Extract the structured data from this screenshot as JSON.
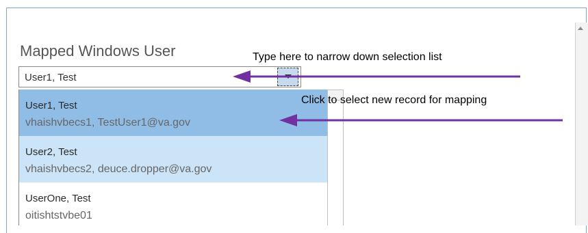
{
  "field": {
    "title": "Mapped Windows User",
    "value": "User1, Test"
  },
  "options": [
    {
      "name": "User1, Test",
      "detail": "vhaishvbecs1, TestUser1@va.gov",
      "state": "selected"
    },
    {
      "name": "User2, Test",
      "detail": "vhaishvbecs2, deuce.dropper@va.gov",
      "state": "hover"
    },
    {
      "name": "UserOne, Test",
      "detail": "oitishtstvbe01",
      "state": "normal"
    }
  ],
  "annotations": {
    "type_hint": "Type here to narrow down selection list",
    "click_hint": "Click to select new record for mapping",
    "arrow_color": "#7030a0"
  },
  "icons": {
    "dropdown": "chevron-down-icon",
    "scroll_up": "scroll-up-icon"
  }
}
